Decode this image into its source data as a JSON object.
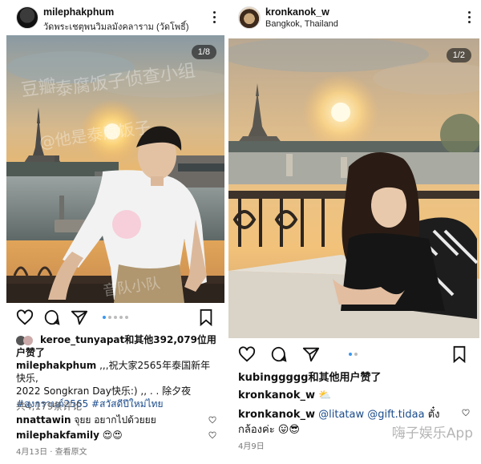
{
  "left_post": {
    "username": "milephakphum",
    "location": "วัดพระเชตุพนวิมลมังคลาราม (วัดโพธิ์)",
    "slide_counter": "1/8",
    "watermark": [
      "豆瓣",
      "泰腐饭子侦查小组",
      "@他是泰腐饭子",
      "音队小队"
    ],
    "likes_prefix": "keroe_tunyapat",
    "likes_suffix": "和其他392,079位用",
    "likes_suffix2": "户赞了",
    "caption_user": "milephakphum",
    "caption_line1": " ,,,祝大家2565年泰国新年快乐,",
    "caption_line2": "2022 Songkran Day快乐:) ,, . . 除夕夜",
    "hashtags": "#สงกรานต์2565 #สวัสดีปีใหม่ไทย",
    "comment_count": "共4,179条评论",
    "comment1_user": "nnattawin",
    "comment1_text": " จุยย อยากไปด้วยยย",
    "comment2_user": "milephakfamily",
    "comment2_text": " 😍😍",
    "date": "4月13日",
    "see_translation": "· 查看原文"
  },
  "right_post": {
    "username": "kronkanok_w",
    "location": "Bangkok, Thailand",
    "slide_counter": "1/2",
    "likes_user": "kubinggggg",
    "likes_suffix": "和其他用户赞了",
    "caption_user": "kronkanok_w",
    "caption_text": " ⛅",
    "comment_user": "kronkanok_w",
    "comment_mention1": " @litataw",
    "comment_mention2": " @gift.tidaa",
    "comment_text_end": " ตั๋ง",
    "comment_line2": "กล้องค่ะ 😛😎",
    "date": "4月9日",
    "bottom_watermark": "嗨子娱乐App"
  },
  "colors": {
    "link": "#1a4b8c",
    "dot_active": "#3897f0",
    "bg": "#ffffff"
  },
  "icons": [
    "heart-icon",
    "comment-icon",
    "share-icon",
    "bookmark-icon",
    "more-icon"
  ]
}
